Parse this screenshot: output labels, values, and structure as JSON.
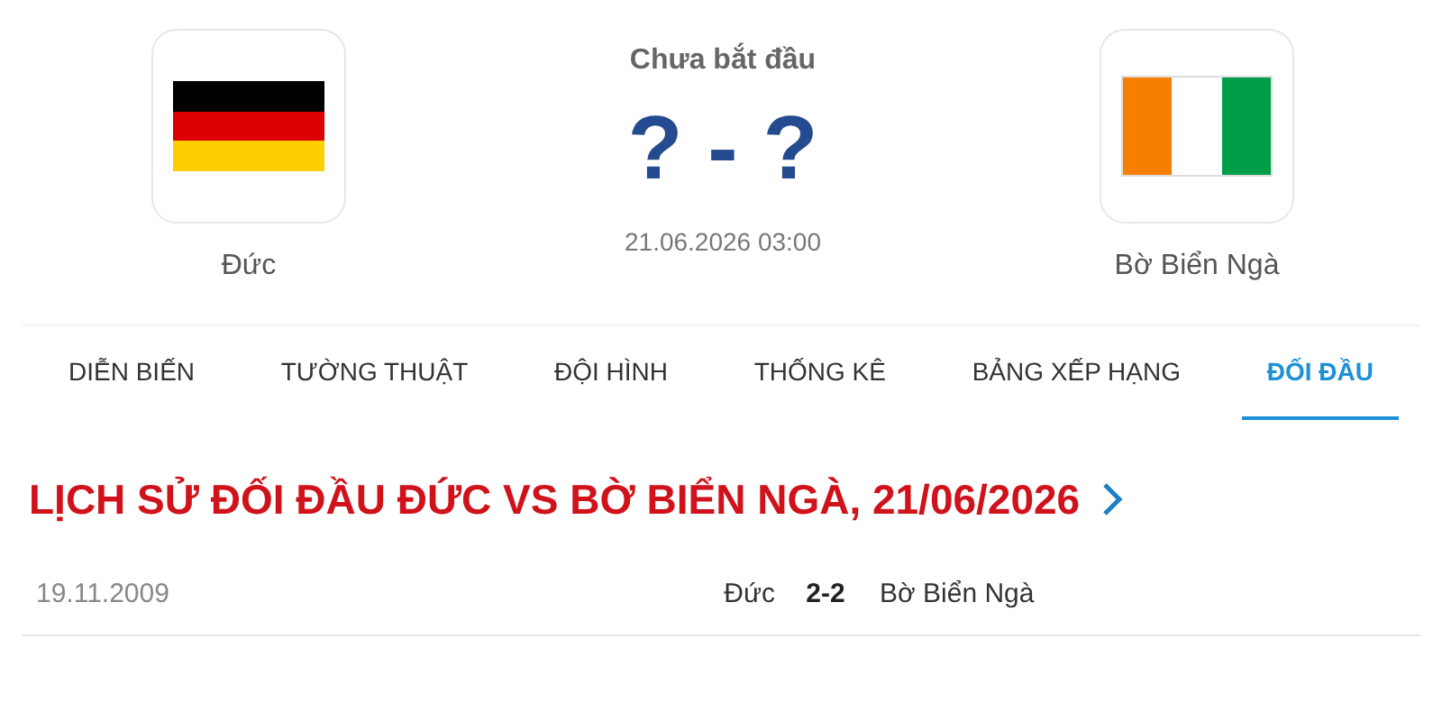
{
  "match": {
    "status": "Chưa bắt đầu",
    "score": "? - ?",
    "datetime": "21.06.2026 03:00",
    "home": {
      "name": "Đức"
    },
    "away": {
      "name": "Bờ Biển Ngà"
    }
  },
  "tabs": [
    {
      "label": "DIỄN BIẾN",
      "selected": false
    },
    {
      "label": "TƯỜNG THUẬT",
      "selected": false
    },
    {
      "label": "ĐỘI HÌNH",
      "selected": false
    },
    {
      "label": "THỐNG KÊ",
      "selected": false
    },
    {
      "label": "BẢNG XẾP HẠNG",
      "selected": false
    },
    {
      "label": "ĐỐI ĐẦU",
      "selected": true
    }
  ],
  "head_to_head": {
    "title": "LỊCH SỬ ĐỐI ĐẦU ĐỨC VS BỜ BIỂN NGÀ, 21/06/2026",
    "matches": [
      {
        "date": "19.11.2009",
        "home": "Đức",
        "score": "2-2",
        "away": "Bờ Biển Ngà"
      }
    ]
  }
}
